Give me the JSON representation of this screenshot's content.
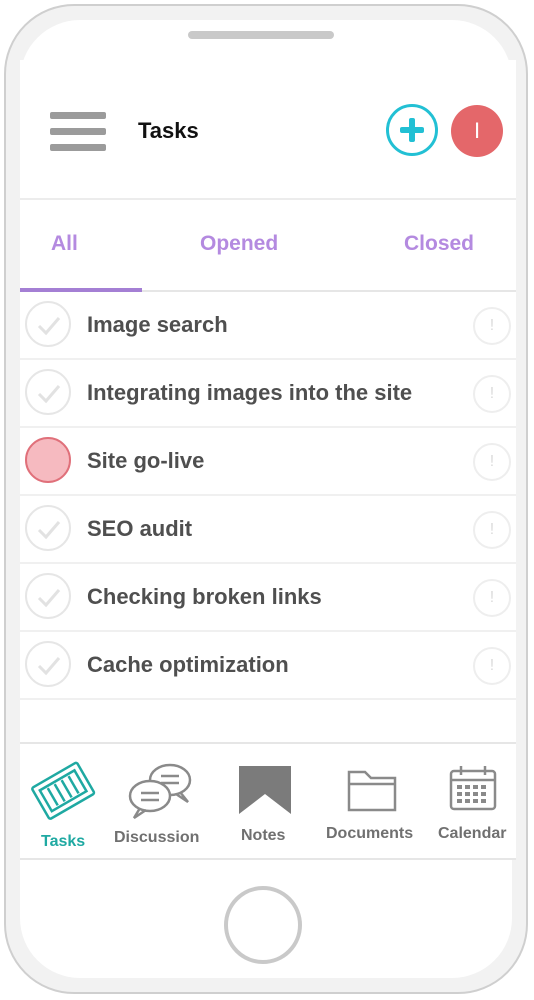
{
  "header": {
    "title": "Tasks",
    "avatar_initial": "I"
  },
  "tabs": [
    {
      "label": "All",
      "active": true
    },
    {
      "label": "Opened",
      "active": false
    },
    {
      "label": "Closed",
      "active": false
    }
  ],
  "tasks": [
    {
      "label": "Image search",
      "status": "done"
    },
    {
      "label": "Integrating images into the site",
      "status": "done"
    },
    {
      "label": "Site go-live",
      "status": "urgent"
    },
    {
      "label": "SEO audit",
      "status": "done"
    },
    {
      "label": "Checking broken links",
      "status": "done"
    },
    {
      "label": "Cache optimization",
      "status": "done"
    }
  ],
  "info_glyph": "!",
  "bottom_nav": [
    {
      "label": "Tasks",
      "icon": "tasks-icon",
      "active": true
    },
    {
      "label": "Discussion",
      "icon": "discussion-icon",
      "active": false
    },
    {
      "label": "Notes",
      "icon": "notes-icon",
      "active": false
    },
    {
      "label": "Documents",
      "icon": "documents-icon",
      "active": false
    },
    {
      "label": "Calendar",
      "icon": "calendar-icon",
      "active": false
    }
  ],
  "colors": {
    "accent_cyan": "#22c0d4",
    "avatar_red": "#e4676a",
    "tab_purple": "#b48ae0",
    "active_teal": "#1fa9a2",
    "urgent_fill": "#f6bac0"
  }
}
